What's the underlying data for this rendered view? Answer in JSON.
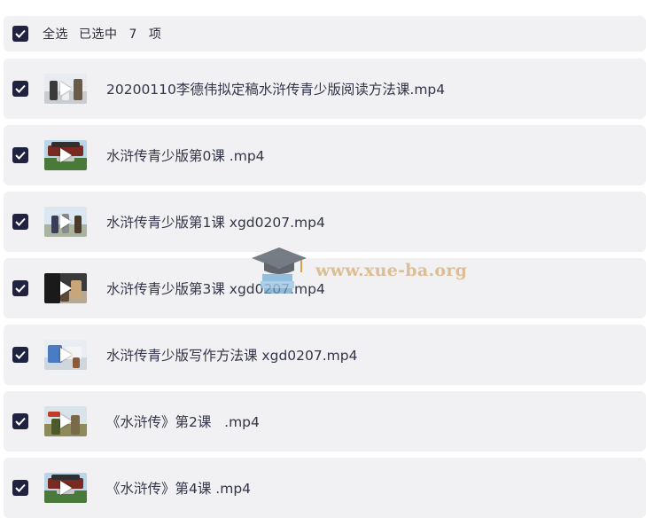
{
  "header": {
    "select_all_label": "全选",
    "selected_prefix": "已选中",
    "selected_count": "7",
    "selected_suffix": "项"
  },
  "files": [
    {
      "name": "20200110李德伟拟定稿水浒传青少版阅读方法课.mp4",
      "thumb": "figures-white",
      "checked": true
    },
    {
      "name": "水浒传青少版第0课 .mp4",
      "thumb": "gate-red",
      "checked": true
    },
    {
      "name": "水浒传青少版第1课 xgd0207.mp4",
      "thumb": "figures-sky",
      "checked": true
    },
    {
      "name": "水浒传青少版第3课 xgd0207.mp4",
      "thumb": "dark-scene",
      "checked": true
    },
    {
      "name": "水浒传青少版写作方法课 xgd0207.mp4",
      "thumb": "grid-board",
      "checked": true
    },
    {
      "name": "《水浒传》第2课   .mp4",
      "thumb": "figures-olive",
      "checked": true
    },
    {
      "name": "《水浒传》第4课 .mp4",
      "thumb": "gate-red",
      "checked": true
    }
  ],
  "watermark": {
    "text": "www.xue-ba.org",
    "icon": "graduation-cap-icon"
  },
  "colors": {
    "checkbox": "#1f2340",
    "row_bg": "#f1f1f3",
    "watermark": "#d9b98d"
  }
}
